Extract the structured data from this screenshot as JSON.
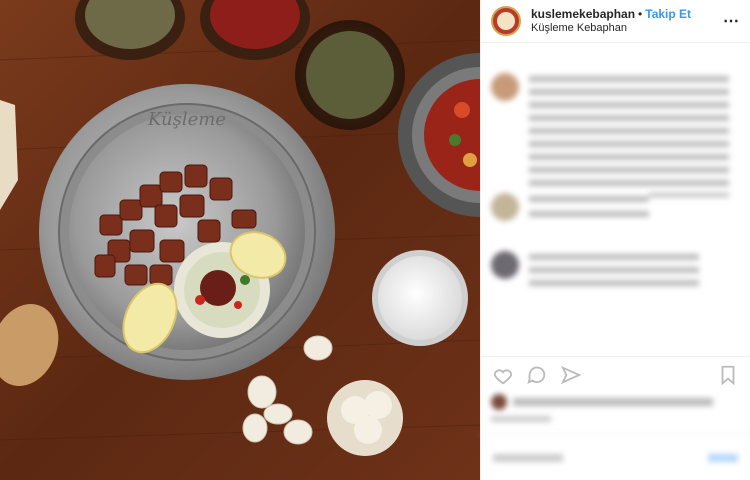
{
  "header": {
    "username": "kuslemekebaphan",
    "separator": "•",
    "follow_label": "Takip Et",
    "location": "Küşleme Kebaphan",
    "more_icon": "⋯"
  },
  "photo": {
    "plate_brand": "Küşleme",
    "colors": {
      "table": "#6b3219",
      "plate": "#a8a8a8",
      "meat": "#7a2e1c"
    }
  },
  "colors": {
    "link": "#3897f0",
    "text": "#262626",
    "muted": "#999999"
  }
}
